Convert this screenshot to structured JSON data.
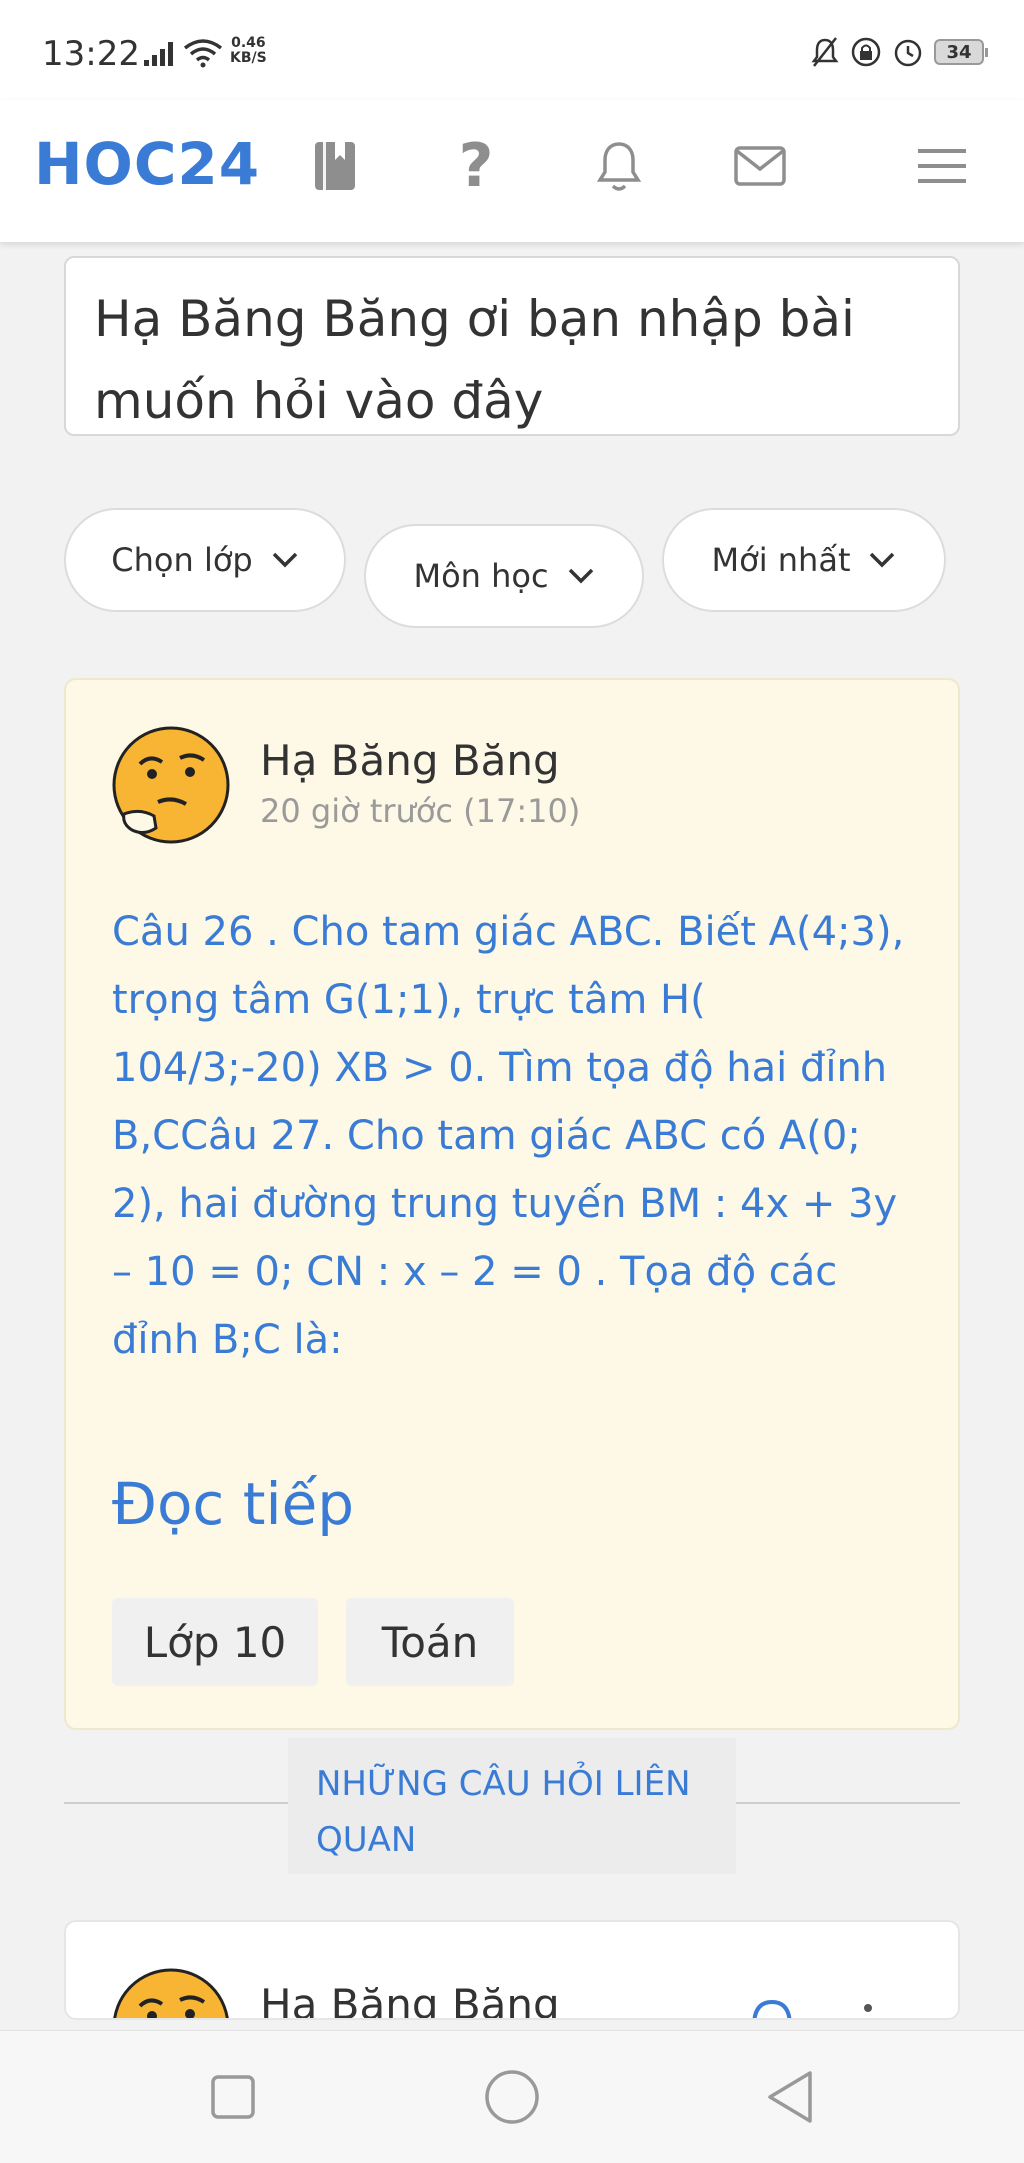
{
  "status_bar": {
    "time": "13:22",
    "net_speed_value": "0.46",
    "net_speed_unit": "KB/S",
    "battery": "34"
  },
  "header": {
    "logo": "HOC24",
    "icons": [
      "book-icon",
      "question-icon",
      "bell-icon",
      "mail-icon",
      "menu-icon"
    ]
  },
  "ask": {
    "placeholder": "Hạ Băng Băng ơi bạn nhập bài muốn hỏi vào đây"
  },
  "filters": {
    "grade": "Chọn lớp",
    "subject": "Môn học",
    "sort": "Mới nhất"
  },
  "question": {
    "author": "Hạ Băng Băng",
    "time": "20 giờ trước (17:10)",
    "text": "Câu 26 . Cho tam giác ABC. Biết A(4;3), trọng tâm G(1;1), trực tâm H( 104/3;-20) XB > 0. Tìm tọa độ hai đỉnh B,CCâu 27. Cho tam giác ABC có A(0; 2), hai đường trung tuyến BM : 4x + 3y – 10 = 0; CN : x – 2 = 0 . Tọa độ các đỉnh B;C là:",
    "read_more": "Đọc tiếp",
    "tags": [
      "Lớp 10",
      "Toán"
    ]
  },
  "related": {
    "label": "NHỮNG CÂU HỎI LIÊN QUAN"
  },
  "next_question": {
    "author": "Hạ Băng Băng"
  },
  "colors": {
    "brand": "#3a7bd5",
    "card_bg": "#fdf9e6",
    "page_bg": "#f2f2f2"
  }
}
